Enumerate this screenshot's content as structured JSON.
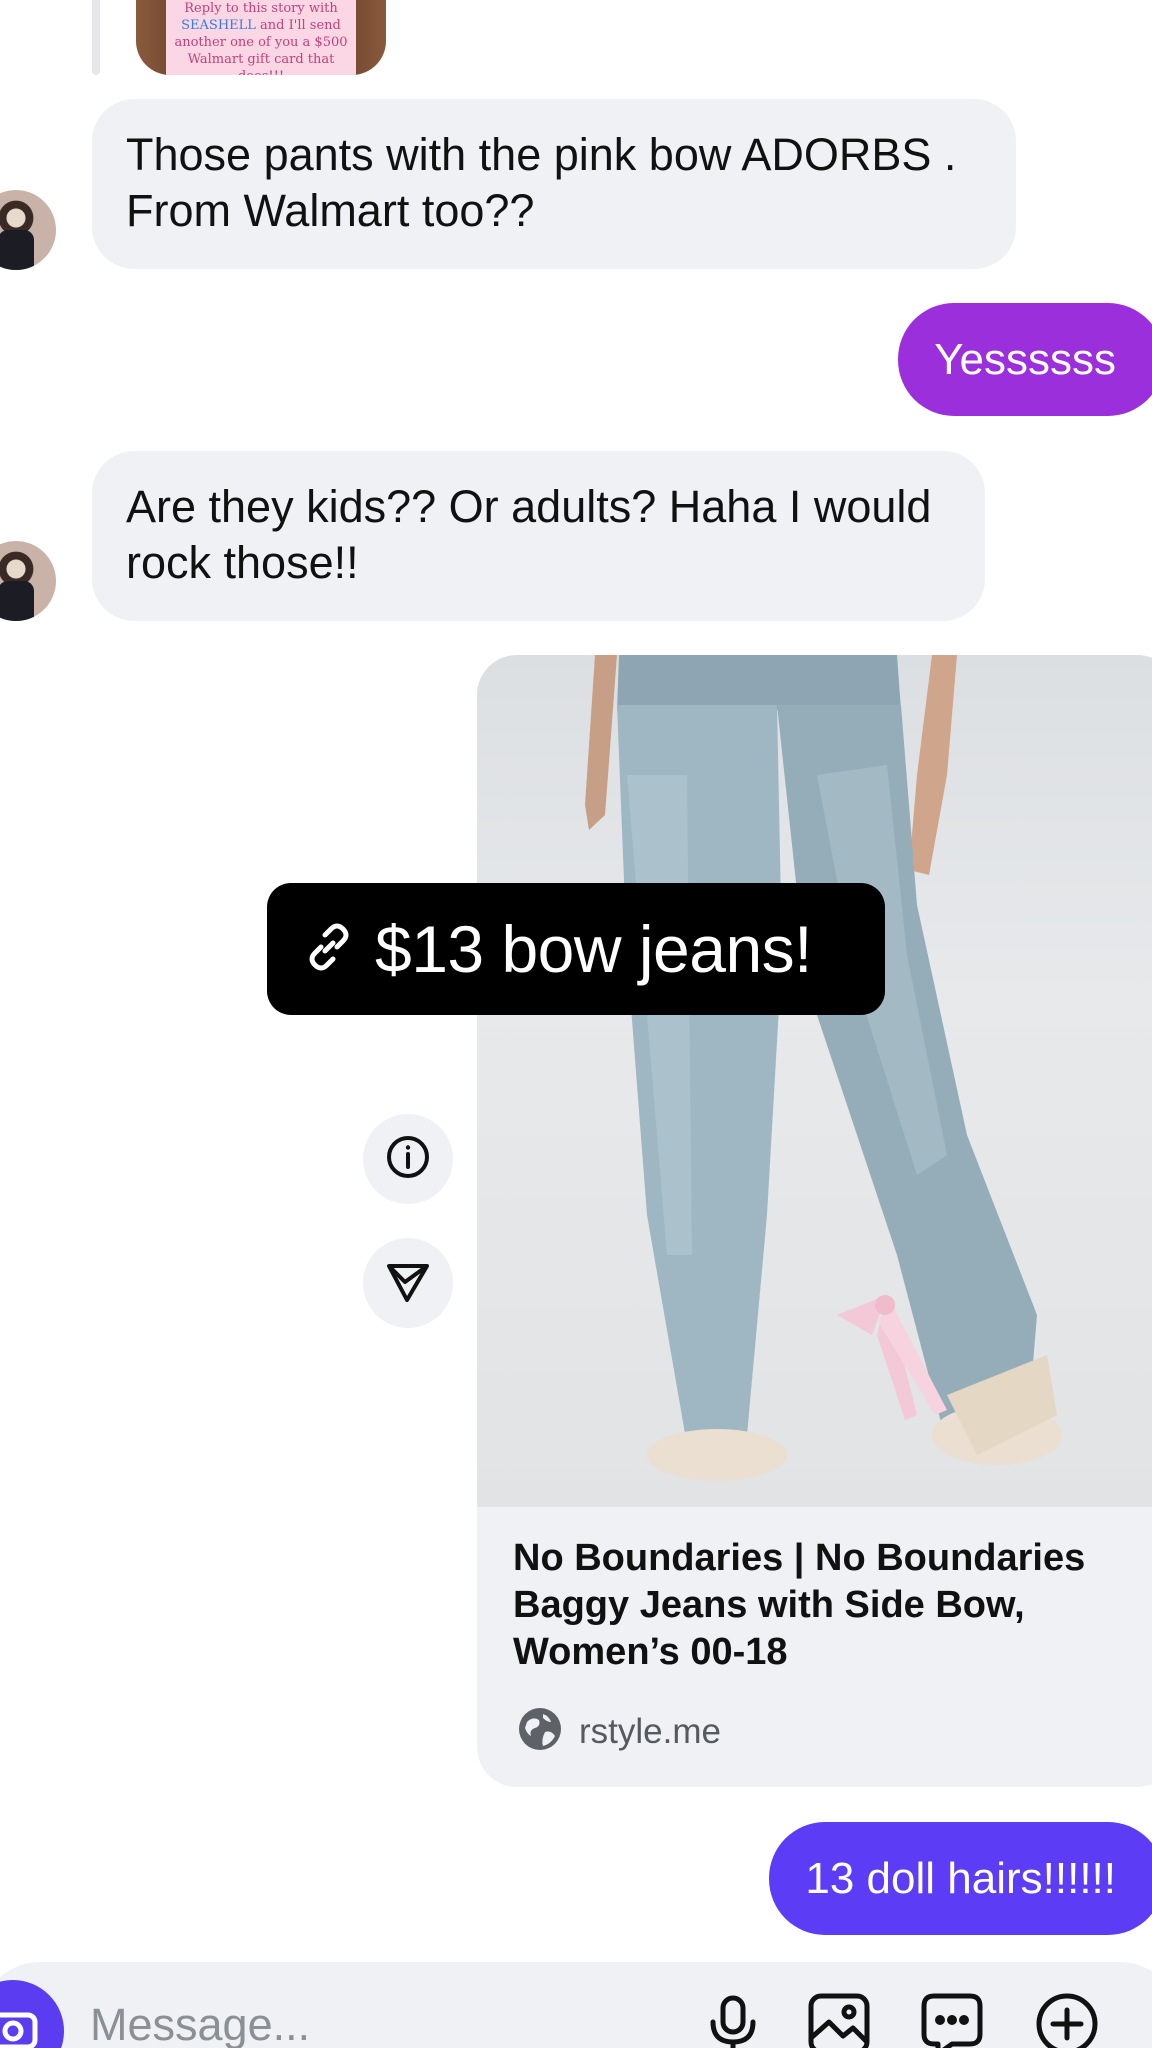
{
  "story_reply": {
    "line1": "Reply to this story with",
    "highlight": "SEASHELL",
    "line2_rest": " and I'll send",
    "line3": "another one of you a $500",
    "line4": "Walmart gift card that does!!!"
  },
  "messages": [
    {
      "id": "m1",
      "direction": "incoming",
      "text": "Those pants with the pink bow ADORBS . From Walmart too??"
    },
    {
      "id": "m2",
      "direction": "outgoing",
      "text": "Yessssss"
    },
    {
      "id": "m3",
      "direction": "incoming",
      "text": "Are they kids?? Or adults? Haha I would rock those!!"
    },
    {
      "id": "m5",
      "direction": "outgoing",
      "text": "13 doll hairs!!!!!!"
    }
  ],
  "link_share": {
    "sticker_text": "$13 bow jeans!",
    "title": "No Boundaries | No Boundaries Baggy Jeans with Side Bow, Women’s 00-18",
    "domain": "rstyle.me"
  },
  "composer": {
    "placeholder": "Message..."
  },
  "colors": {
    "incoming_bubble": "#eff1f4",
    "outgoing_purple": "#9b2fdc",
    "outgoing_blue_purple": "#5c3cf5",
    "camera_button": "#5b3cf0"
  },
  "icons": {
    "link_sticker": "link-icon",
    "info_button": "info-icon",
    "share_button": "send-icon",
    "domain": "globe-icon",
    "camera": "camera-icon",
    "mic": "microphone-icon",
    "gallery": "image-icon",
    "sticker": "sticker-icon",
    "more": "plus-icon"
  }
}
